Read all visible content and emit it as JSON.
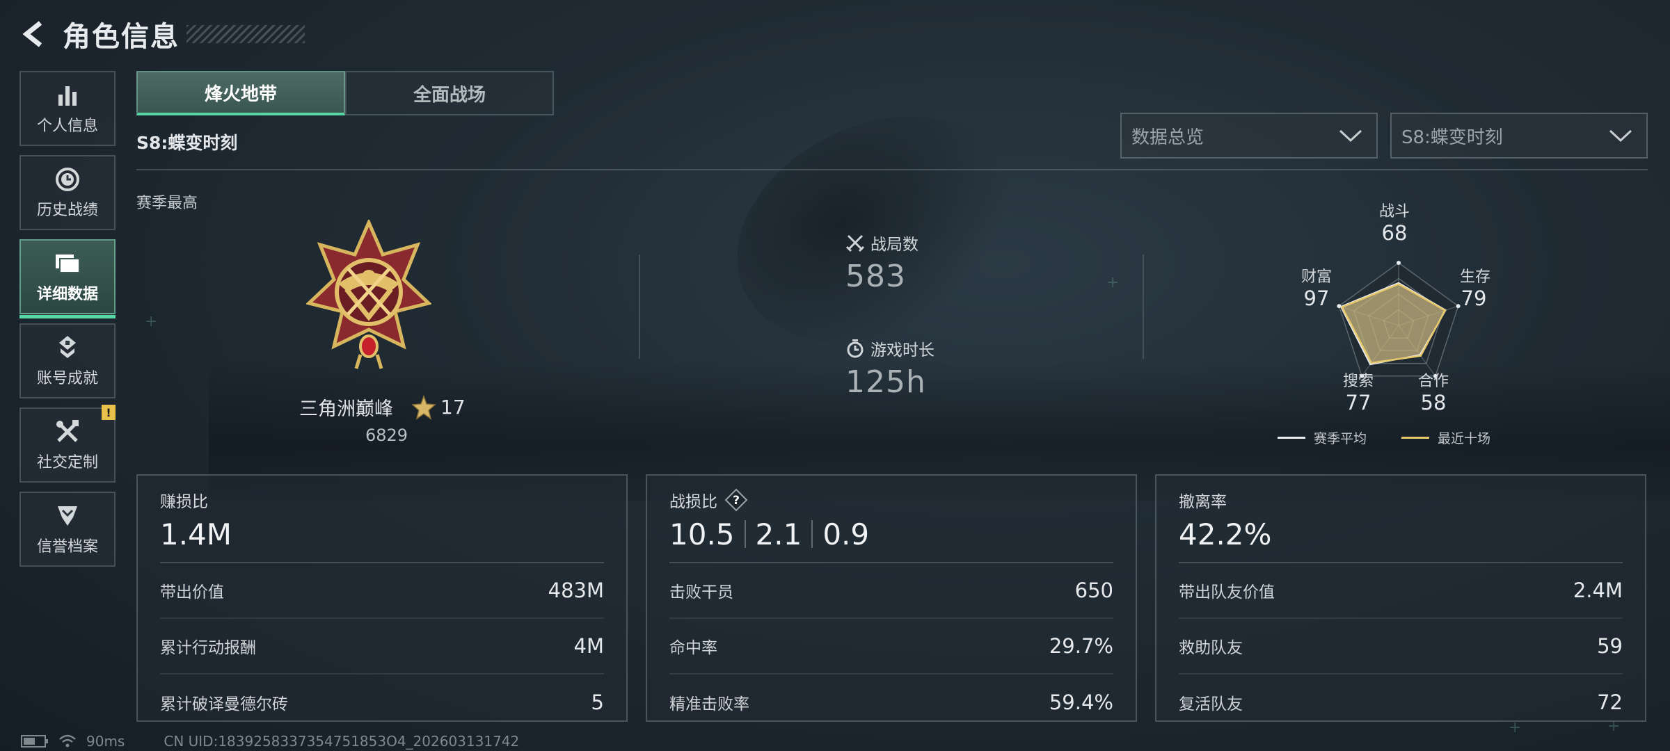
{
  "header": {
    "title": "角色信息"
  },
  "sidebar": {
    "items": [
      {
        "label": "个人信息",
        "icon": "bar-chart-icon",
        "active": false
      },
      {
        "label": "历史战绩",
        "icon": "history-clock-icon",
        "active": false
      },
      {
        "label": "详细数据",
        "icon": "folder-data-icon",
        "active": true
      },
      {
        "label": "账号成就",
        "icon": "achievement-badge-icon",
        "active": false
      },
      {
        "label": "社交定制",
        "icon": "tools-cross-icon",
        "active": false,
        "badge": "!"
      },
      {
        "label": "信誉档案",
        "icon": "shield-chevron-icon",
        "active": false
      }
    ]
  },
  "tabs": [
    {
      "label": "烽火地带",
      "active": true
    },
    {
      "label": "全面战场",
      "active": false
    }
  ],
  "season_title": "S8:蝶变时刻",
  "filters": {
    "view": "数据总览",
    "season": "S8:蝶变时刻"
  },
  "season_best_label": "赛季最高",
  "rank": {
    "name": "三角洲巅峰",
    "stars": "17",
    "points": "6829"
  },
  "stats": {
    "matches_label": "战局数",
    "matches_value": "583",
    "playtime_label": "游戏时长",
    "playtime_value": "125h"
  },
  "radar": {
    "labels": {
      "combat": "战斗",
      "survival": "生存",
      "cooperation": "合作",
      "search": "搜索",
      "wealth": "财富"
    },
    "values": {
      "combat": "68",
      "survival": "79",
      "cooperation": "58",
      "search": "77",
      "wealth": "97"
    },
    "season_avg": [
      68,
      79,
      58,
      77,
      97
    ],
    "recent_ten": [
      66,
      78,
      60,
      74,
      95
    ],
    "legend": {
      "season_avg": "赛季平均",
      "recent_ten": "最近十场"
    },
    "colors": {
      "season_avg": "#e9ecee",
      "recent_ten": "#e7c86a",
      "fill": "#c9b77f"
    }
  },
  "panels": {
    "profit": {
      "title": "赚损比",
      "value": "1.4M",
      "rows": [
        {
          "label": "带出价值",
          "value": "483M"
        },
        {
          "label": "累计行动报酬",
          "value": "4M"
        },
        {
          "label": "累计破译曼德尔砖",
          "value": "5"
        }
      ]
    },
    "kd": {
      "title": "战损比",
      "values": [
        "10.5",
        "2.1",
        "0.9"
      ],
      "rows": [
        {
          "label": "击败干员",
          "value": "650"
        },
        {
          "label": "命中率",
          "value": "29.7%"
        },
        {
          "label": "精准击败率",
          "value": "59.4%"
        }
      ]
    },
    "extract": {
      "title": "撤离率",
      "value": "42.2%",
      "rows": [
        {
          "label": "带出队友价值",
          "value": "2.4M"
        },
        {
          "label": "救助队友",
          "value": "59"
        },
        {
          "label": "复活队友",
          "value": "72"
        }
      ]
    }
  },
  "footer": {
    "ping": "90ms",
    "uid": "CN UID:1839258337354751853O4_202603131742"
  },
  "colors": {
    "accent": "#57d7a5",
    "badge": "#e8c14a"
  }
}
